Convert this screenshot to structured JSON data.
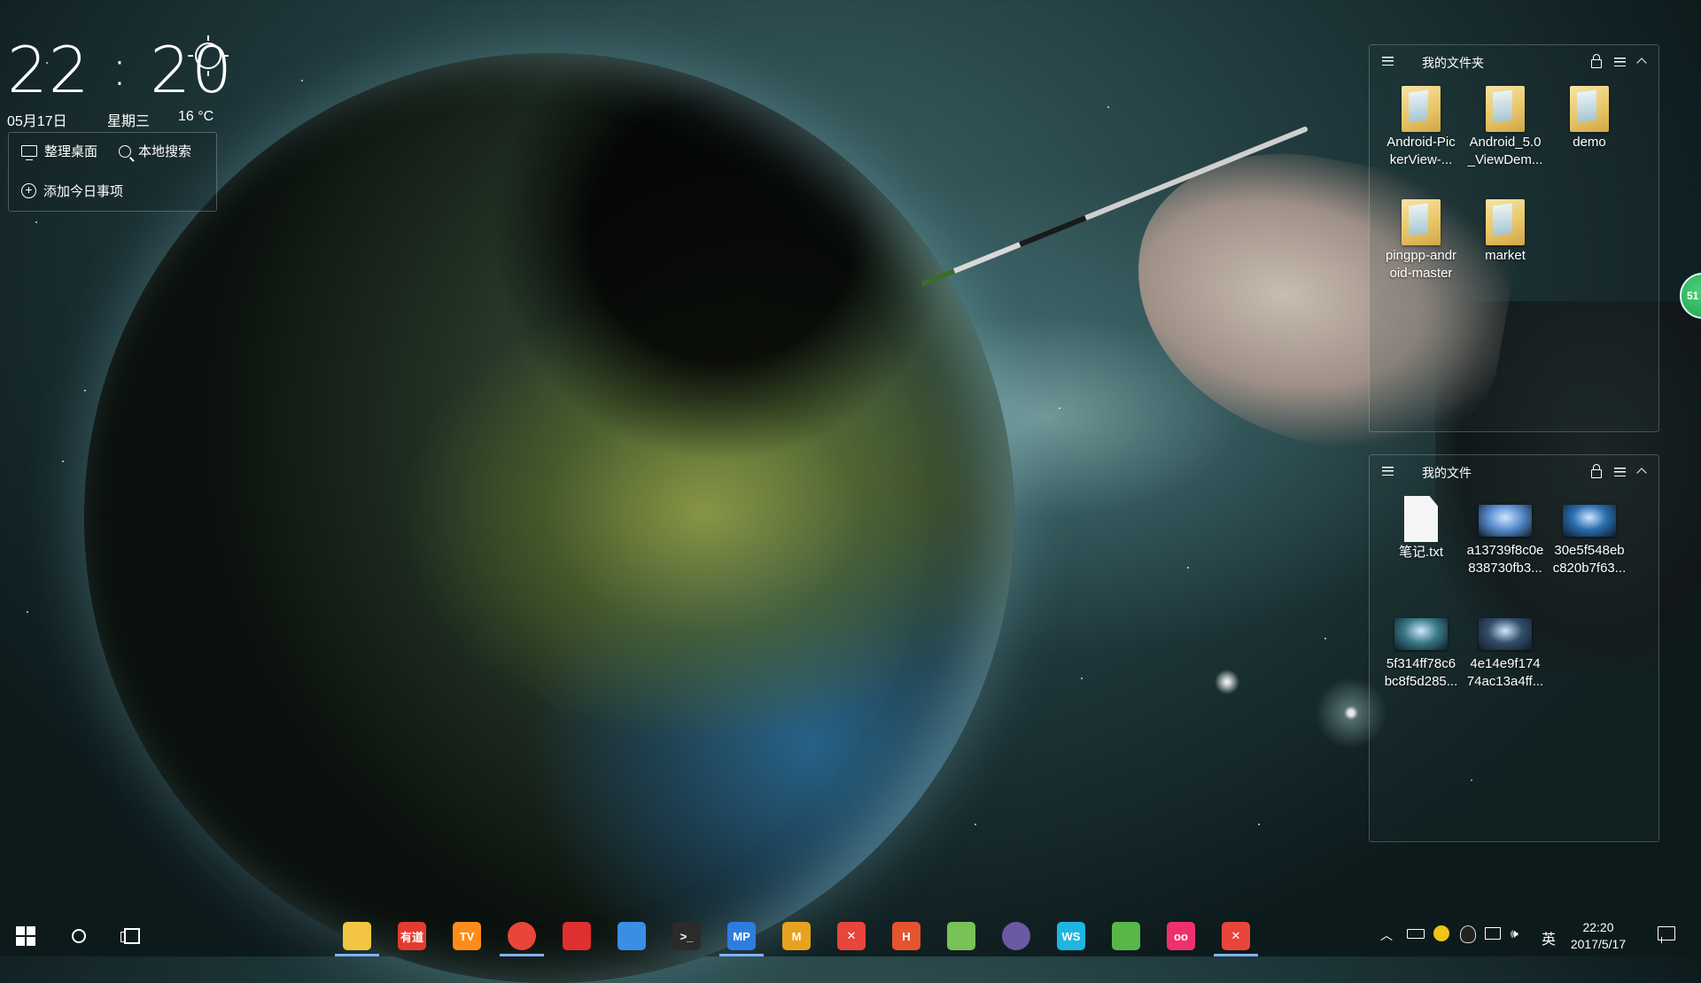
{
  "clock": {
    "hour": "22",
    "separator": ":",
    "minute": "20",
    "weather_icon": "sun-icon",
    "date": "05月17日",
    "weekday": "星期三",
    "temperature": "16 °C"
  },
  "desktop_tools": {
    "organize_label": "整理桌面",
    "search_label": "本地搜索",
    "add_event_label": "添加今日事项"
  },
  "fence_folders": {
    "title": "我的文件夹",
    "items": [
      {
        "label": "Android-PickerView-...",
        "line1": "Android-Pic",
        "line2": "kerView-...",
        "icon": "folder-icon"
      },
      {
        "label": "Android_5.0_ViewDem...",
        "line1": "Android_5.0",
        "line2": "_ViewDem...",
        "icon": "folder-icon"
      },
      {
        "label": "demo",
        "line1": "demo",
        "line2": "",
        "icon": "folder-icon"
      },
      {
        "label": "pingpp-android-master",
        "line1": "pingpp-andr",
        "line2": "oid-master",
        "icon": "folder-icon"
      },
      {
        "label": "market",
        "line1": "market",
        "line2": "",
        "icon": "folder-icon"
      }
    ]
  },
  "fence_files": {
    "title": "我的文件",
    "items": [
      {
        "line1": "笔记.txt",
        "line2": "",
        "icon": "text-file-icon"
      },
      {
        "line1": "a13739f8c0e",
        "line2": "838730fb3...",
        "icon": "image-file-icon",
        "color": "#5a8fd0"
      },
      {
        "line1": "30e5f548eb",
        "line2": "c820b7f63...",
        "icon": "image-file-icon",
        "color": "#2a6fb0"
      },
      {
        "line1": "5f314ff78c6",
        "line2": "bc8f5d285...",
        "icon": "image-file-icon",
        "color": "#3a7a86"
      },
      {
        "line1": "4e14e9f174",
        "line2": "74ac13a4ff...",
        "icon": "image-file-icon",
        "color": "#35506a"
      }
    ]
  },
  "side_badge": "51",
  "taskbar": {
    "apps": [
      {
        "name": "file-explorer-icon",
        "text": "",
        "color": "#f4c542"
      },
      {
        "name": "youdao-dict-icon",
        "text": "有道",
        "color": "#e33b2e"
      },
      {
        "name": "mango-tv-icon",
        "text": "TV",
        "color": "#ff8c1a"
      },
      {
        "name": "chrome-icon",
        "text": "",
        "color": "#e9453a"
      },
      {
        "name": "netease-music-icon",
        "text": "",
        "color": "#e02f2f"
      },
      {
        "name": "baidu-netdisk-icon",
        "text": "",
        "color": "#3a8ee6"
      },
      {
        "name": "terminal-icon",
        "text": ">_",
        "color": "#2b2b2b"
      },
      {
        "name": "mp-icon",
        "text": "MP",
        "color": "#2d7de0"
      },
      {
        "name": "m-app-icon",
        "text": "M",
        "color": "#e8a21f"
      },
      {
        "name": "xmind-icon",
        "text": "✕",
        "color": "#e8453c"
      },
      {
        "name": "hbuilder-icon",
        "text": "H",
        "color": "#e5542f"
      },
      {
        "name": "android-studio-icon",
        "text": "",
        "color": "#79c257"
      },
      {
        "name": "eclipse-icon",
        "text": "",
        "color": "#6a5aa6"
      },
      {
        "name": "webstorm-icon",
        "text": "WS",
        "color": "#1fb5e3"
      },
      {
        "name": "evernote-icon",
        "text": "",
        "color": "#57b847"
      },
      {
        "name": "flickr-icon",
        "text": "oo",
        "color": "#f0306d"
      },
      {
        "name": "xmind-2-icon",
        "text": "✕",
        "color": "#e8453c"
      }
    ],
    "tray": {
      "ime": "英",
      "time": "22:20",
      "date": "2017/5/17"
    }
  }
}
